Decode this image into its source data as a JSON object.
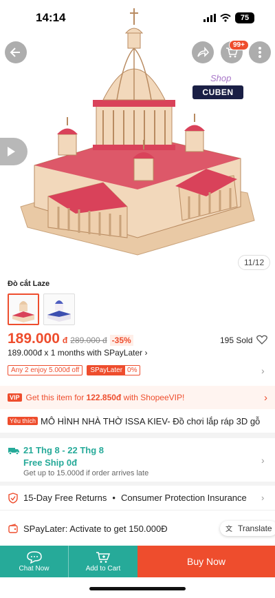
{
  "status": {
    "time": "14:14",
    "battery": "75"
  },
  "header": {
    "cart_badge": "99+"
  },
  "gallery": {
    "counter": "11/12",
    "shop_word": "Shop",
    "shop_name": "CUBEN"
  },
  "variation": {
    "label": "Đò cắt Laze"
  },
  "price": {
    "current": "189.000",
    "currency": "đ",
    "original": "289.000 đ",
    "discount": "-35%",
    "sold": "195 Sold",
    "installment": "189.000đ x 1 months with SPayLater"
  },
  "promos": {
    "voucher": "Any 2 enjoy 5.000đ off",
    "spaylater_label": "SPayLater",
    "spaylater_rate": "0%"
  },
  "vip": {
    "badge": "VIP",
    "text_prefix": "Get this item for ",
    "amount": "122.850đ",
    "text_suffix": " with ShopeeVIP!"
  },
  "product": {
    "badge": "Yêu thích",
    "title": "MÔ HÌNH NHÀ THỜ ISSA KIEV- Đồ chơi lắp ráp 3D gỗ"
  },
  "shipping": {
    "dates": "21 Thg 8 - 22 Thg 8",
    "free_ship": "Free Ship 0đ",
    "note": "Get up to 15.000đ if order arrives late"
  },
  "guarantee": {
    "returns": "15-Day Free Returns",
    "separator": "•",
    "insurance": "Consumer Protection Insurance"
  },
  "spaylater_row": {
    "text": "SPayLater: Activate to get 150.000Đ"
  },
  "translate": {
    "label": "Translate"
  },
  "bottom": {
    "chat": "Chat Now",
    "add_to_cart": "Add to Cart",
    "buy_now": "Buy Now"
  },
  "colors": {
    "accent": "#ee4d2d",
    "teal": "#26aa99"
  }
}
